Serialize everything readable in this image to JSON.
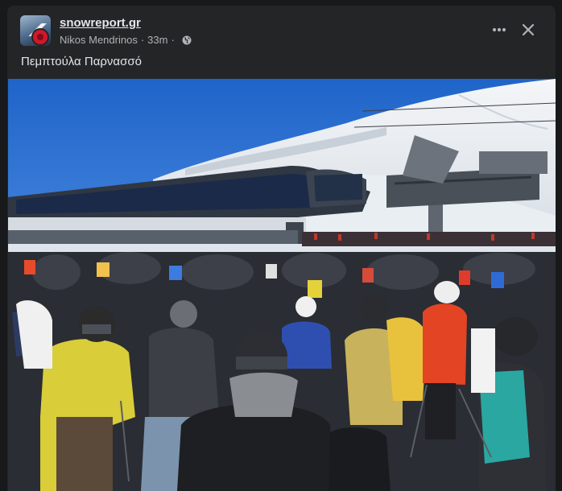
{
  "post": {
    "page_name": "snowreport.gr",
    "author": "Nikos Mendrinos",
    "separator": "·",
    "time_ago": "33m",
    "audience_icon": "globe-icon",
    "caption": "Πεμπτούλα Παρνασσό",
    "photo": {
      "scene": "crowd of skiers queuing at a chairlift station on a snowy mountain under a clear blue sky"
    }
  },
  "actions": {
    "more_icon": "more-horizontal-icon",
    "close_icon": "close-icon"
  },
  "colors": {
    "panel": "#242526",
    "background": "#18191a",
    "primary_text": "#e4e6eb",
    "secondary_text": "#b0b3b8",
    "sky": "#2c6fd0"
  }
}
